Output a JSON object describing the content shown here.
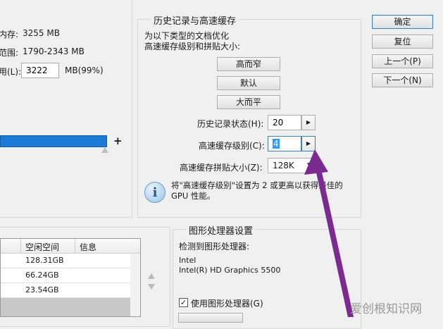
{
  "memory": {
    "available_label": "内存:",
    "available_value": "3255 MB",
    "range_label": "范围:",
    "range_value": "1790-2343 MB",
    "use_label": "用(L):",
    "use_value": "3222",
    "use_unit": "MB(99%)",
    "slider_plus": "+",
    "slider_fraction": 0.99
  },
  "history_cache": {
    "title": "历史记录与高速缓存",
    "optimize_line1": "为以下类型的文档优化",
    "optimize_line2": "高速缓存级别和拼贴大小:",
    "btn_tall_thin": "高而窄",
    "btn_default": "默认",
    "btn_big_flat": "大而平",
    "history_states_label": "历史记录状态(H):",
    "history_states_value": "20",
    "cache_levels_label": "高速缓存级别(C):",
    "cache_levels_value": "4",
    "tile_size_label": "高速缓存拼贴大小(Z):",
    "tile_size_value": "128K",
    "info_text_line1": "将\"高速缓存级别\"设置为 2 或更高以获得最佳的",
    "info_text_line2": "GPU 性能。"
  },
  "dialog_buttons": {
    "ok": "确定",
    "reset": "复位",
    "prev": "上一个(P)",
    "next": "下一个(N)"
  },
  "scratch_disks": {
    "headers": [
      "空闲空间",
      "信息"
    ],
    "rows": [
      {
        "free": "128.31GB",
        "info": ""
      },
      {
        "free": "66.24GB",
        "info": ""
      },
      {
        "free": "23.54GB",
        "info": ""
      }
    ]
  },
  "gpu": {
    "title": "图形处理器设置",
    "detected_label": "检测到图形处理器:",
    "vendor": "Intel",
    "model": "Intel(R) HD Graphics 5500",
    "use_gpu_label": "使用图形处理器(G)"
  },
  "watermark": "爱创根知识网",
  "colors": {
    "slider_fill": "#1c79d6",
    "arrow": "#7b2b8f",
    "selection": "#3399ff"
  }
}
